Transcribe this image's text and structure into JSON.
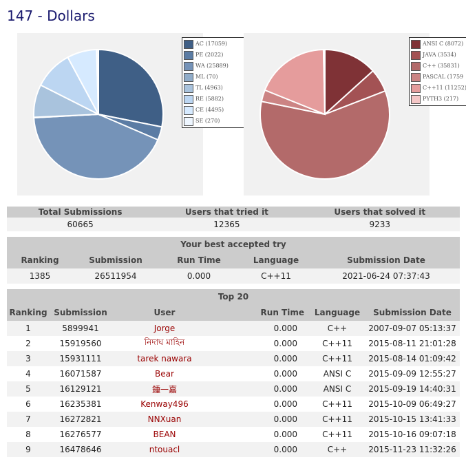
{
  "title": "147 - Dollars",
  "verdict_chart": {
    "legend": [
      "AC (17059)",
      "PE (2022)",
      "WA (25889)",
      "ML (70)",
      "TL (4963)",
      "RE (5882)",
      "CE (4495)",
      "SE (270)"
    ],
    "values": [
      17059,
      2022,
      25889,
      70,
      4963,
      5882,
      4495,
      270
    ],
    "colors": [
      "#3f5f86",
      "#5b7ca4",
      "#7593b8",
      "#90acc9",
      "#a9c3dd",
      "#bcd6f2",
      "#d6eaff",
      "#eef6ff"
    ]
  },
  "language_chart": {
    "legend": [
      "ANSI C (8072)",
      "JAVA (3534)",
      "C++ (35831)",
      "PASCAL (1759",
      "C++11 (11252)",
      "PYTH3 (217)"
    ],
    "values": [
      8072,
      3534,
      35831,
      1759,
      11252,
      217
    ],
    "colors": [
      "#7f3236",
      "#a35254",
      "#b36a6a",
      "#cc8484",
      "#e59c9c",
      "#f4c6c6"
    ]
  },
  "stats": {
    "headers": [
      "Total Submissions",
      "Users that tried it",
      "Users that solved it"
    ],
    "values": [
      "60665",
      "12365",
      "9233"
    ]
  },
  "best_try": {
    "title": "Your best accepted try",
    "headers": [
      "Ranking",
      "Submission",
      "Run Time",
      "Language",
      "Submission Date"
    ],
    "row": [
      "1385",
      "26511954",
      "0.000",
      "C++11",
      "2021-06-24 07:37:43"
    ]
  },
  "top20": {
    "title": "Top 20",
    "headers": [
      "Ranking",
      "Submission",
      "User",
      "Run Time",
      "Language",
      "Submission Date"
    ],
    "rows": [
      [
        "1",
        "5899941",
        "Jorge",
        "0.000",
        "C++",
        "2007-09-07 05:13:37"
      ],
      [
        "2",
        "15919560",
        "নিদাঘ মাহিন",
        "0.000",
        "C++11",
        "2015-08-11 21:01:28"
      ],
      [
        "3",
        "15931111",
        "tarek nawara",
        "0.000",
        "C++11",
        "2015-08-14 01:09:42"
      ],
      [
        "4",
        "16071587",
        "Bear",
        "0.000",
        "ANSI C",
        "2015-09-09 12:55:27"
      ],
      [
        "5",
        "16129121",
        "鍾一嘉",
        "0.000",
        "ANSI C",
        "2015-09-19 14:40:31"
      ],
      [
        "6",
        "16235381",
        "Kenway496",
        "0.000",
        "C++11",
        "2015-10-09 06:49:27"
      ],
      [
        "7",
        "16272821",
        "NNXuan",
        "0.000",
        "C++11",
        "2015-10-15 13:41:33"
      ],
      [
        "8",
        "16276577",
        "BEAN",
        "0.000",
        "C++11",
        "2015-10-16 09:07:18"
      ],
      [
        "9",
        "16478646",
        "ntouacl",
        "0.000",
        "C++",
        "2015-11-23 11:32:26"
      ]
    ]
  }
}
